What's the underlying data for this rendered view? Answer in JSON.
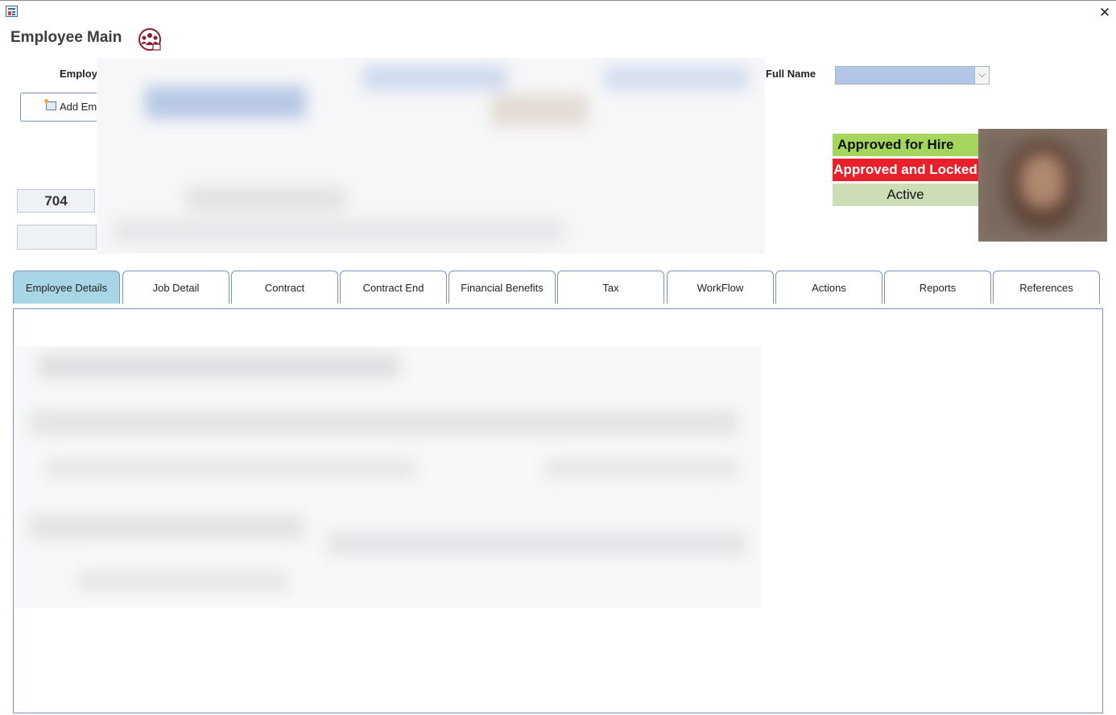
{
  "window": {
    "app_icon": "form-icon",
    "close_icon": "close-icon",
    "close_glyph": "✕"
  },
  "header": {
    "title": "Employee Main",
    "team_icon": "team-icon"
  },
  "form": {
    "employee_label": "Employ",
    "add_button_label": "Add Em",
    "add_button_icon": "add-employee-icon",
    "employee_id": "704",
    "full_name_label": "Full Name",
    "full_name_value": "",
    "dropdown_glyph": "⌵"
  },
  "status": {
    "hire": "Approved for Hire",
    "locked": "Approved and Locked",
    "active": "Active",
    "colors": {
      "hire": "#a4d65e",
      "locked": "#e8202a",
      "active": "#cdddb5"
    }
  },
  "tabs": [
    {
      "label": "Employee Details",
      "active": true
    },
    {
      "label": "Job Detail",
      "active": false
    },
    {
      "label": "Contract",
      "active": false
    },
    {
      "label": "Contract End",
      "active": false
    },
    {
      "label": "Financial Benefits",
      "active": false
    },
    {
      "label": "Tax",
      "active": false
    },
    {
      "label": "WorkFlow",
      "active": false
    },
    {
      "label": "Actions",
      "active": false
    },
    {
      "label": "Reports",
      "active": false
    },
    {
      "label": "References",
      "active": false
    }
  ]
}
